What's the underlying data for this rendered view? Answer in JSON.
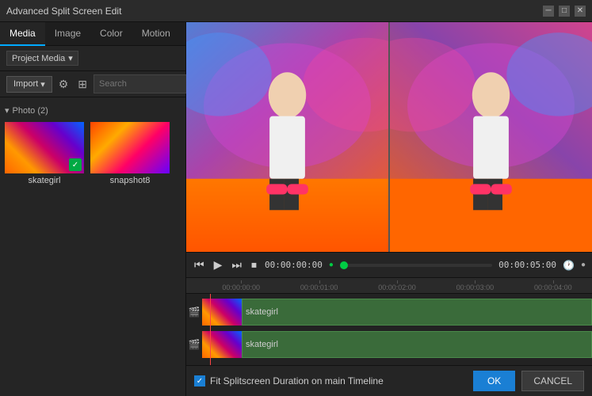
{
  "window": {
    "title": "Advanced Split Screen Edit",
    "controls": [
      "minimize",
      "maximize",
      "close"
    ]
  },
  "tabs": [
    {
      "label": "Media",
      "active": true
    },
    {
      "label": "Image",
      "active": false
    },
    {
      "label": "Color",
      "active": false
    },
    {
      "label": "Motion",
      "active": false
    }
  ],
  "media_panel": {
    "dropdown_label": "Project Media",
    "import_label": "Import",
    "search_placeholder": "Search",
    "section_label": "Photo (2)",
    "items": [
      {
        "name": "skategirl",
        "checked": true
      },
      {
        "name": "snapshot8",
        "checked": false
      }
    ]
  },
  "playback": {
    "time_start": "00:00:00:00",
    "time_end": "00:00:05:00"
  },
  "timeline": {
    "ruler_marks": [
      "00:00:00:00",
      "00:00:01:00",
      "00:00:02:00",
      "00:00:03:00",
      "00:00:04:00"
    ],
    "tracks": [
      {
        "clip_label": "skategirl"
      },
      {
        "clip_label": "skategirl"
      }
    ]
  },
  "bottom_bar": {
    "fit_label": "Fit Splitscreen Duration on main Timeline",
    "ok_label": "OK",
    "cancel_label": "CANCEL"
  }
}
